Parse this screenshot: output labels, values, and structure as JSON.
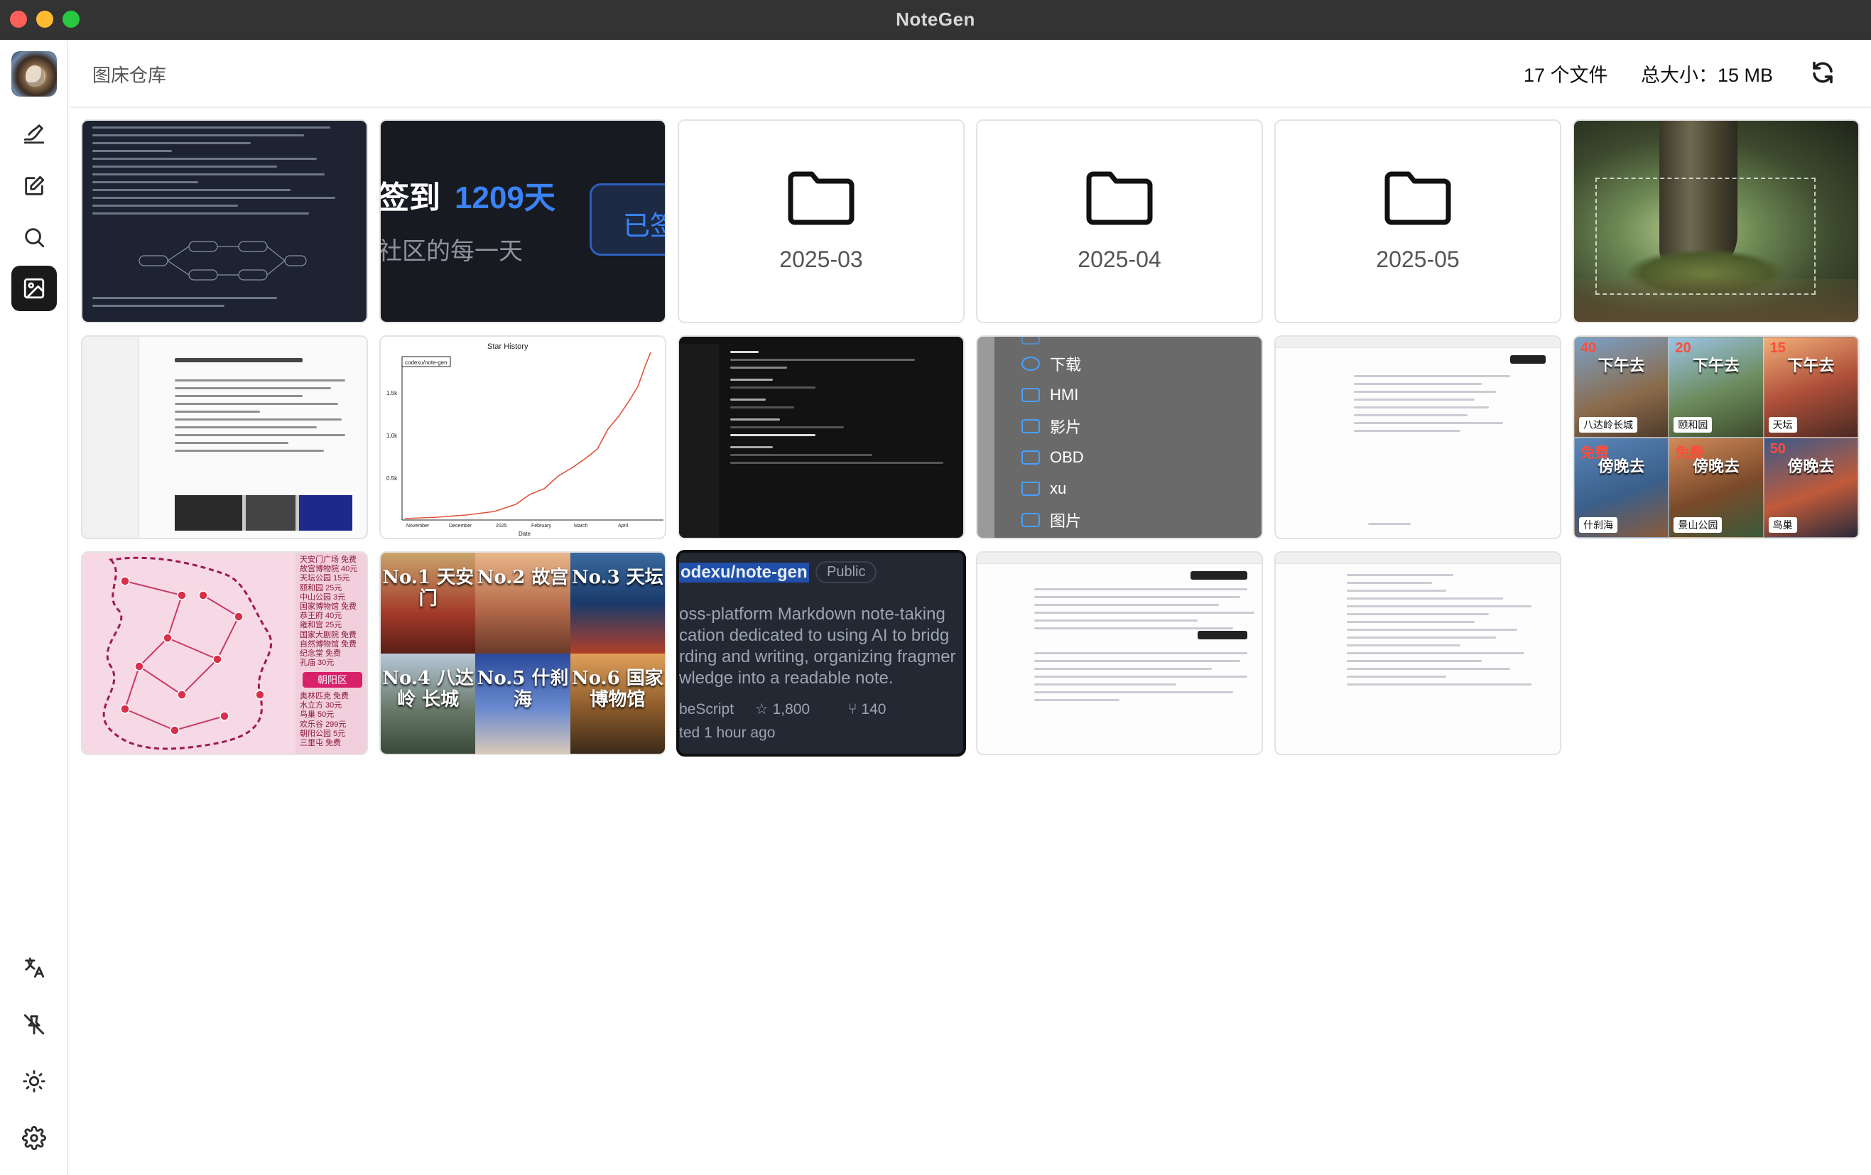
{
  "window": {
    "title": "NoteGen"
  },
  "sidebar": {
    "nav": [
      {
        "name": "record-icon",
        "active": false
      },
      {
        "name": "write-icon",
        "active": false
      },
      {
        "name": "search-icon",
        "active": false
      },
      {
        "name": "image-hosting-icon",
        "active": true
      }
    ],
    "bottom": [
      {
        "name": "translate-icon"
      },
      {
        "name": "pin-off-icon"
      },
      {
        "name": "theme-sun-icon"
      },
      {
        "name": "settings-icon"
      }
    ]
  },
  "header": {
    "title": "图床仓库",
    "file_count": "17 个文件",
    "total_size": "总大小：15 MB"
  },
  "gallery": {
    "folders": [
      "2025-03",
      "2025-04",
      "2025-05"
    ],
    "checkin": {
      "prefix": "签到",
      "days": "1209天",
      "subtitle": "社区的每一天",
      "button": "已签"
    },
    "star_history": {
      "title": "Star History",
      "repo": "codexu/note-gen",
      "x_label": "Date",
      "y_ticks": [
        "1.5k",
        "1.0k",
        "0.5k"
      ],
      "x_ticks": [
        "November",
        "December",
        "2025",
        "February",
        "March",
        "April"
      ]
    },
    "finder": {
      "items": [
        "下载",
        "HMI",
        "影片",
        "OBD",
        "xu",
        "图片"
      ]
    },
    "travel": [
      {
        "num": "40",
        "caption": "下午去",
        "loc": "八达岭长城"
      },
      {
        "num": "20",
        "caption": "下午去",
        "loc": "颐和园"
      },
      {
        "num": "15",
        "caption": "下午去",
        "loc": "天坛"
      },
      {
        "num": "免费",
        "caption": "傍晚去",
        "loc": "什刹海"
      },
      {
        "num": "免费",
        "caption": "傍晚去",
        "loc": "景山公园"
      },
      {
        "num": "50",
        "caption": "傍晚去",
        "loc": "鸟巢"
      }
    ],
    "map": {
      "prices": [
        "天安门广场 免费",
        "故宫博物院 40元",
        "天坛公园 15元",
        "颐和园 25元",
        "中山公园 3元",
        "国家博物馆 免费",
        "恭王府 40元",
        "雍和宫 25元",
        "国家大剧院 免费",
        "自然博物馆 免费",
        "纪念堂 免费",
        "孔庙 30元"
      ],
      "district": "朝阳区",
      "district_prices": [
        "奥林匹克 免费",
        "水立方 30元",
        "鸟巢 50元",
        "欢乐谷 299元",
        "朝阳公园 5元",
        "三里屯 免费"
      ]
    },
    "posters": [
      {
        "label": "No.1 天安门"
      },
      {
        "label": "No.2 故宫"
      },
      {
        "label": "No.3 天坛"
      },
      {
        "label": "No.4 八达岭 长城"
      },
      {
        "label": "No.5 什刹海"
      },
      {
        "label": "No.6 国家 博物馆"
      }
    ],
    "github": {
      "repo": "odexu/note-gen",
      "visibility": "Public",
      "description": [
        "oss-platform Markdown note-taking",
        "cation dedicated to using AI to bridg",
        "rding and writing, organizing fragmer",
        "wledge into a readable note."
      ],
      "language": "beScript",
      "stars": "1,800",
      "forks": "140",
      "updated": "ted 1 hour ago"
    }
  }
}
